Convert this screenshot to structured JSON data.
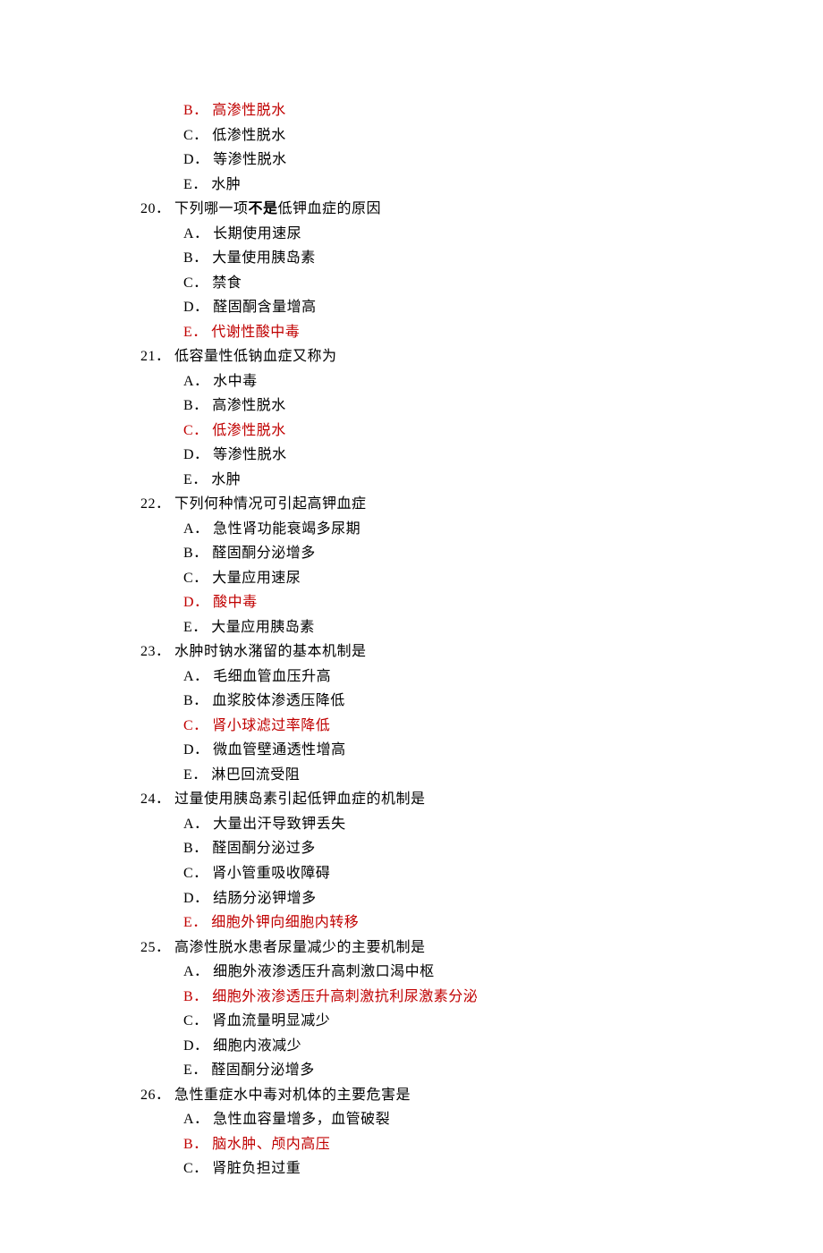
{
  "q19_remainder": {
    "options": [
      {
        "letter": "B．",
        "text": "高渗性脱水",
        "answer": true
      },
      {
        "letter": "C．",
        "text": "低渗性脱水",
        "answer": false
      },
      {
        "letter": "D．",
        "text": "等渗性脱水",
        "answer": false
      },
      {
        "letter": "E．",
        "text": "水肿",
        "answer": false
      }
    ]
  },
  "questions": [
    {
      "num": "20．",
      "text_parts": [
        "下列哪一项",
        "不是",
        "低钾血症的原因"
      ],
      "bold_part": 1,
      "options": [
        {
          "letter": "A．",
          "text": "长期使用速尿",
          "answer": false
        },
        {
          "letter": "B．",
          "text": "大量使用胰岛素",
          "answer": false
        },
        {
          "letter": "C．",
          "text": "禁食",
          "answer": false
        },
        {
          "letter": "D．",
          "text": "醛固酮含量增高",
          "answer": false
        },
        {
          "letter": "E．",
          "text": "代谢性酸中毒",
          "answer": true
        }
      ]
    },
    {
      "num": "21．",
      "text_parts": [
        "低容量性低钠血症又称为"
      ],
      "options": [
        {
          "letter": "A．",
          "text": "水中毒",
          "answer": false
        },
        {
          "letter": "B．",
          "text": "高渗性脱水",
          "answer": false
        },
        {
          "letter": "C．",
          "text": "低渗性脱水",
          "answer": true
        },
        {
          "letter": "D．",
          "text": "等渗性脱水",
          "answer": false
        },
        {
          "letter": "E．",
          "text": "水肿",
          "answer": false
        }
      ]
    },
    {
      "num": "22．",
      "text_parts": [
        "下列何种情况可引起高钾血症"
      ],
      "options": [
        {
          "letter": "A．",
          "text": "急性肾功能衰竭多尿期",
          "answer": false
        },
        {
          "letter": "B．",
          "text": "醛固酮分泌增多",
          "answer": false
        },
        {
          "letter": "C．",
          "text": "大量应用速尿",
          "answer": false
        },
        {
          "letter": "D．",
          "text": "酸中毒",
          "answer": true
        },
        {
          "letter": "E．",
          "text": "大量应用胰岛素",
          "answer": false
        }
      ]
    },
    {
      "num": "23．",
      "text_parts": [
        "水肿时钠水潴留的基本机制是"
      ],
      "options": [
        {
          "letter": "A．",
          "text": "毛细血管血压升高",
          "answer": false
        },
        {
          "letter": "B．",
          "text": "血浆胶体渗透压降低",
          "answer": false
        },
        {
          "letter": "C．",
          "text": "肾小球滤过率降低",
          "answer": true
        },
        {
          "letter": "D．",
          "text": "微血管壁通透性增高",
          "answer": false
        },
        {
          "letter": "E．",
          "text": "淋巴回流受阻",
          "answer": false
        }
      ]
    },
    {
      "num": "24．",
      "text_parts": [
        "过量使用胰岛素引起低钾血症的机制是"
      ],
      "options": [
        {
          "letter": "A．",
          "text": "大量出汗导致钾丢失",
          "answer": false
        },
        {
          "letter": "B．",
          "text": "醛固酮分泌过多",
          "answer": false
        },
        {
          "letter": "C．",
          "text": "肾小管重吸收障碍",
          "answer": false
        },
        {
          "letter": "D．",
          "text": "结肠分泌钾增多",
          "answer": false
        },
        {
          "letter": "E．",
          "text": "细胞外钾向细胞内转移",
          "answer": true
        }
      ]
    },
    {
      "num": "25．",
      "text_parts": [
        "高渗性脱水患者尿量减少的主要机制是"
      ],
      "options": [
        {
          "letter": "A．",
          "text": "细胞外液渗透压升高刺激口渴中枢",
          "answer": false
        },
        {
          "letter": "B．",
          "text": "细胞外液渗透压升高刺激抗利尿激素分泌",
          "answer": true
        },
        {
          "letter": "C．",
          "text": "肾血流量明显减少",
          "answer": false
        },
        {
          "letter": "D．",
          "text": "细胞内液减少",
          "answer": false
        },
        {
          "letter": "E．",
          "text": "醛固酮分泌增多",
          "answer": false
        }
      ]
    },
    {
      "num": "26．",
      "text_parts": [
        "急性重症水中毒对机体的主要危害是"
      ],
      "options": [
        {
          "letter": "A．",
          "text": "急性血容量增多，血管破裂",
          "answer": false
        },
        {
          "letter": "B．",
          "text": "脑水肿、颅内高压",
          "answer": true
        },
        {
          "letter": "C．",
          "text": "肾脏负担过重",
          "answer": false
        }
      ]
    }
  ]
}
